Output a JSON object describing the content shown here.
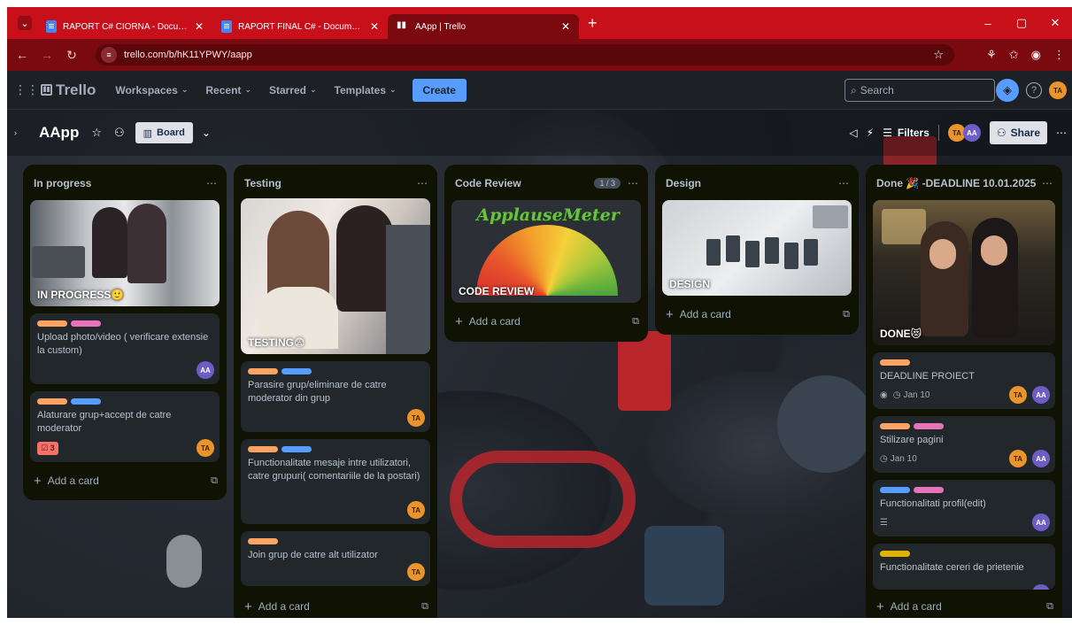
{
  "browser": {
    "tabs": [
      {
        "title": "RAPORT C# CIORNA - Docume",
        "active": false
      },
      {
        "title": "RAPORT FINAL C# - Document",
        "active": false
      },
      {
        "title": "AApp | Trello",
        "active": true
      }
    ],
    "url": "trello.com/b/hK11YPWY/aapp"
  },
  "header": {
    "logo": "Trello",
    "nav": [
      "Workspaces",
      "Recent",
      "Starred",
      "Templates"
    ],
    "create_label": "Create",
    "search_placeholder": "Search",
    "user_initials": "TA"
  },
  "board": {
    "name": "AApp",
    "view_label": "Board",
    "filters_label": "Filters",
    "share_label": "Share",
    "members": [
      "TA",
      "AA"
    ]
  },
  "lists": [
    {
      "title": "In progress",
      "cover": "IN PROGRESS🙂",
      "cards": [
        {
          "text": "Upload photo/video ( verificare extensie la custom)",
          "members": [
            "AA"
          ]
        },
        {
          "text": "Alaturare grup+accept de catre moderator",
          "badge": "3",
          "members": [
            "TA"
          ]
        }
      ],
      "add": "Add a card"
    },
    {
      "title": "Testing",
      "cover": "TESTING😨",
      "cards": [
        {
          "text": "Parasire grup/eliminare de catre moderator din grup",
          "members": [
            "TA"
          ]
        },
        {
          "text": "Functionalitate mesaje intre utilizatori, catre grupuri( comentariile de la postari)",
          "members": [
            "TA"
          ]
        },
        {
          "text": "Join grup de catre alt utilizator",
          "members": [
            "TA"
          ]
        }
      ],
      "add": "Add a card"
    },
    {
      "title": "Code Review",
      "count": "1 / 3",
      "cover": "CODE REVIEW",
      "meter_title": "ApplauseMeter",
      "add": "Add a card"
    },
    {
      "title": "Design",
      "cover": "DESIGN",
      "add": "Add a card"
    },
    {
      "title": "Done 🎉 -DEADLINE 10.01.2025",
      "cover": "DONE😻",
      "cards": [
        {
          "text": "DEADLINE PROIECT",
          "due": "Jan 10",
          "members": [
            "TA",
            "AA"
          ]
        },
        {
          "text": "Stilizare pagini",
          "due": "Jan 10",
          "members": [
            "TA",
            "AA"
          ]
        },
        {
          "text": "Functionalitati profil(edit)",
          "members": [
            "AA"
          ]
        },
        {
          "text": "Functionalitate cereri de prietenie",
          "members": [
            "AA"
          ]
        }
      ],
      "add": "Add a card"
    }
  ],
  "colors": {
    "tabstrip": "#c8101b",
    "accent": "#579dff",
    "list_bg": "#101204",
    "card_bg": "#22272b"
  }
}
